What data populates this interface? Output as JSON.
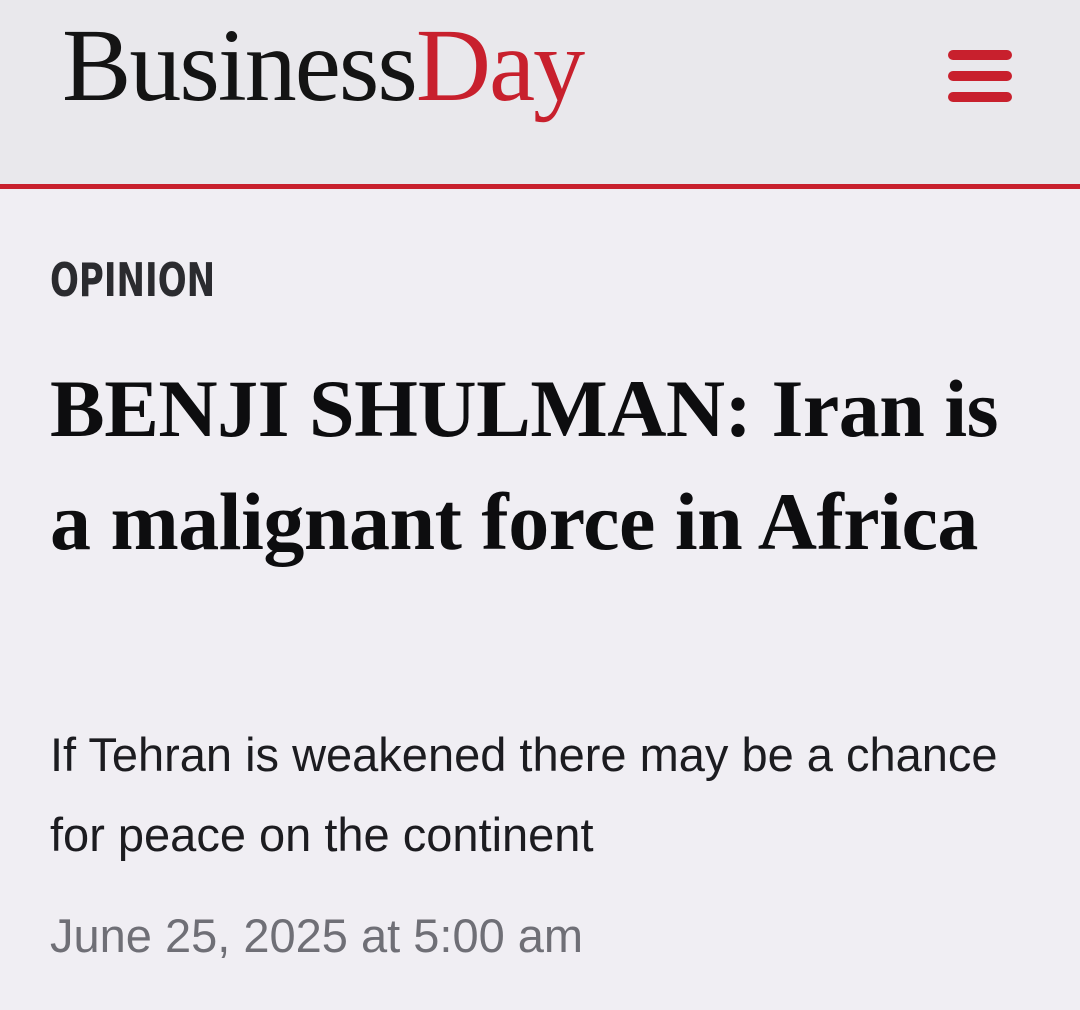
{
  "header": {
    "logo_part1": "Business",
    "logo_part2": "Day",
    "menu_icon": "hamburger-menu-icon",
    "accent_color": "#c8202d"
  },
  "article": {
    "section": "OPINION",
    "headline": "BENJI SHULMAN: Iran is a malignant force in Africa",
    "subheadline": "If Tehran is weakened there may be a chance for peace on the continent",
    "date": "June 25, 2025 at 5:00 am"
  }
}
